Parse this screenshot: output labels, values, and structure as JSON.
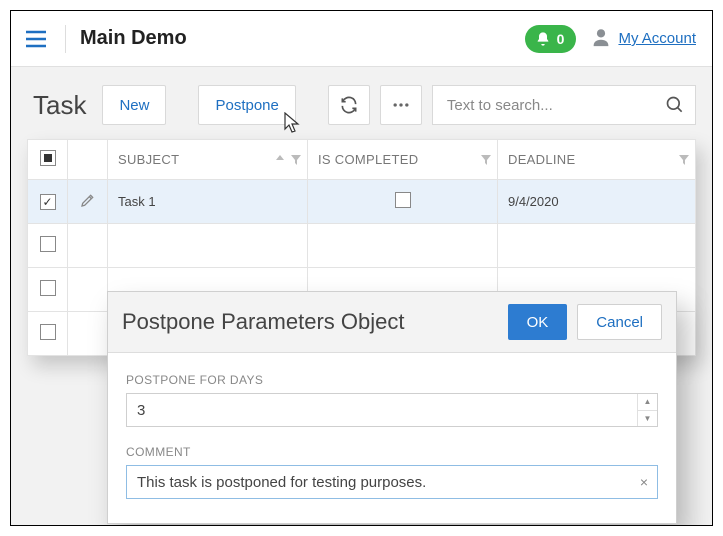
{
  "header": {
    "title": "Main Demo",
    "notifications_count": "0",
    "account_link": "My Account"
  },
  "page": {
    "title": "Task",
    "buttons": {
      "new": "New",
      "postpone": "Postpone"
    },
    "search_placeholder": "Text to search..."
  },
  "table": {
    "columns": {
      "subject": "SUBJECT",
      "is_completed": "IS COMPLETED",
      "deadline": "DEADLINE"
    },
    "rows": [
      {
        "selected": true,
        "subject": "Task 1",
        "is_completed": false,
        "deadline": "9/4/2020"
      }
    ]
  },
  "dialog": {
    "title": "Postpone Parameters Object",
    "ok": "OK",
    "cancel": "Cancel",
    "fields": {
      "days_label": "POSTPONE FOR DAYS",
      "days_value": "3",
      "comment_label": "COMMENT",
      "comment_value": "This task is postponed for testing purposes."
    }
  }
}
